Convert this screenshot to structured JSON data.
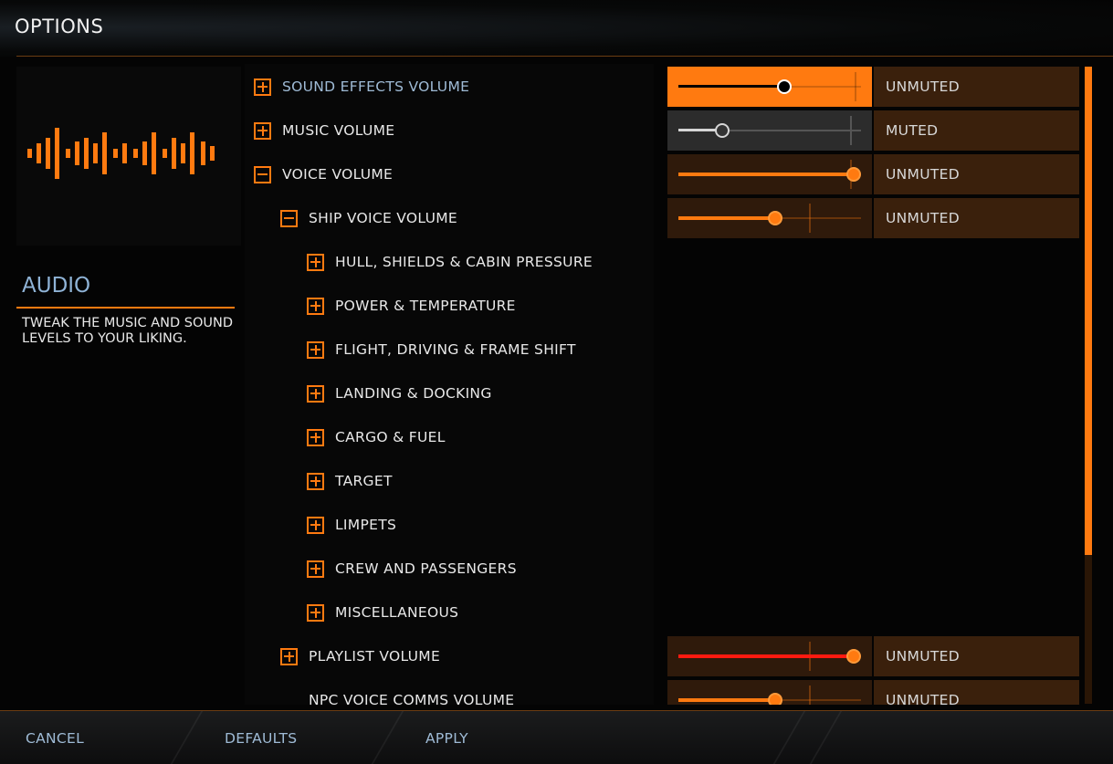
{
  "header": {
    "title": "OPTIONS"
  },
  "side": {
    "icon": "audio-waveform-icon",
    "heading": "AUDIO",
    "description": "TWEAK THE MUSIC AND SOUND LEVELS TO YOUR LIKING."
  },
  "accent_color": "#ff7a10",
  "settings": [
    {
      "label": "SOUND EFFECTS VOLUME",
      "expander": "plus",
      "level": 0.58,
      "status": "UNMUTED"
    },
    {
      "label": "MUSIC VOLUME",
      "expander": "plus",
      "level": 0.24,
      "status": "MUTED"
    },
    {
      "label": "VOICE VOLUME",
      "expander": "minus",
      "level": 0.96,
      "status": "UNMUTED"
    },
    {
      "label": "SHIP VOICE VOLUME",
      "expander": "minus",
      "level": 0.53,
      "status": "UNMUTED"
    },
    {
      "label": "HULL, SHIELDS & CABIN PRESSURE",
      "expander": "plus"
    },
    {
      "label": "POWER & TEMPERATURE",
      "expander": "plus"
    },
    {
      "label": "FLIGHT, DRIVING & FRAME SHIFT",
      "expander": "plus"
    },
    {
      "label": "LANDING & DOCKING",
      "expander": "plus"
    },
    {
      "label": "CARGO & FUEL",
      "expander": "plus"
    },
    {
      "label": "TARGET",
      "expander": "plus"
    },
    {
      "label": "LIMPETS",
      "expander": "plus"
    },
    {
      "label": "CREW AND PASSENGERS",
      "expander": "plus"
    },
    {
      "label": "MISCELLANEOUS",
      "expander": "plus"
    },
    {
      "label": "PLAYLIST VOLUME",
      "expander": "plus",
      "level": 0.96,
      "status": "UNMUTED"
    },
    {
      "label": "NPC VOICE COMMS VOLUME",
      "expander": "none",
      "level": 0.53,
      "status": "UNMUTED"
    }
  ],
  "footer": {
    "cancel": "CANCEL",
    "defaults": "DEFAULTS",
    "apply": "APPLY"
  }
}
